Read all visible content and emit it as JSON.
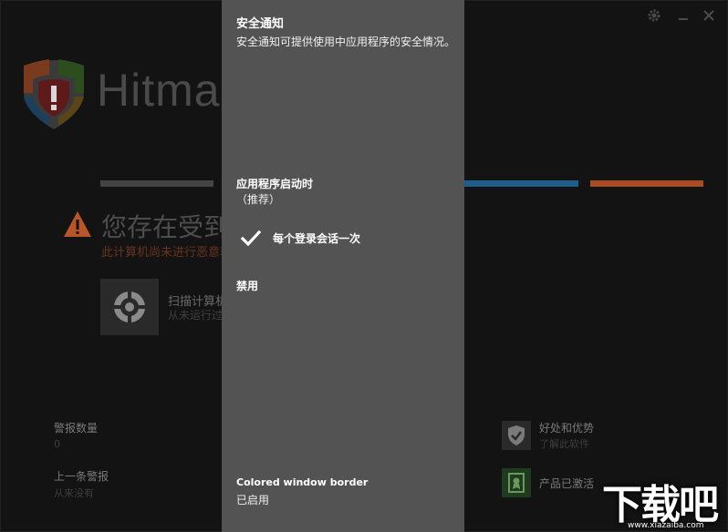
{
  "app": {
    "logo_text": "Hitma",
    "status_title": "您存在受到",
    "status_subtitle": "此计算机尚未进行恶意软",
    "scan": {
      "title": "扫描计算机",
      "subtitle": "从未运行过"
    },
    "alerts": {
      "label": "警报数量",
      "value": "0"
    },
    "last_alert": {
      "label": "上一条警报",
      "value": "从来没有"
    },
    "benefits": {
      "label": "好处和优势",
      "sub": "了解此软件"
    },
    "product": {
      "label": "产品已激活"
    },
    "colors": {
      "seg1": "#444444",
      "seg2": "#1f5e8a",
      "seg3": "#a84a22",
      "accent_orange": "#a84a22"
    },
    "icons": [
      "gear-icon",
      "minimize-icon",
      "close-icon",
      "shield-logo-icon",
      "warning-icon",
      "scan-target-icon",
      "shield-check-icon",
      "certificate-icon"
    ]
  },
  "panel": {
    "title": "安全通知",
    "description": "安全通知可提供使用中应用程序的安全情况。",
    "options": [
      {
        "label": "应用程序启动时",
        "sub": "（推荐）"
      },
      {
        "label": "每个登录会话一次",
        "selected": true
      },
      {
        "label": "禁用"
      }
    ],
    "footer": {
      "title": "Colored window border",
      "value": "已启用"
    }
  },
  "watermark": {
    "text": "下载吧",
    "url": "www.xiazaiba.com"
  }
}
